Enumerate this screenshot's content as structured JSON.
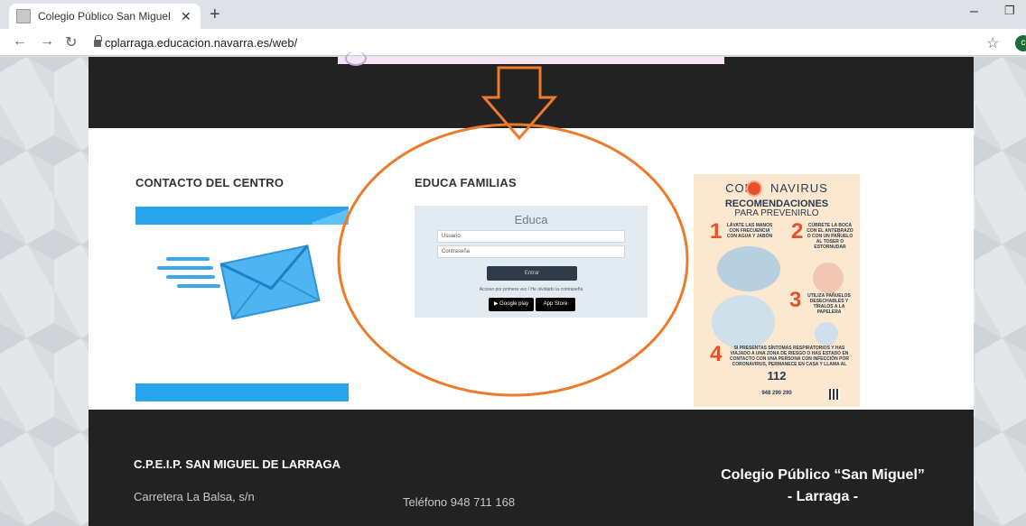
{
  "browser": {
    "tab_title": "Colegio Público San Miguel de L",
    "tab_close": "✕",
    "new_tab": "+",
    "url": "cplarraga.educacion.navarra.es/web/",
    "profile_initial": "c"
  },
  "contact": {
    "heading": "CONTACTO DEL CENTRO"
  },
  "educa": {
    "heading": "EDUCA FAMILIAS",
    "title": "Educa",
    "user_placeholder": "Usuario",
    "password_placeholder": "Contraseña",
    "enter_label": "Entrar",
    "access_text": "Acceso por primera vez / He olvidado la contraseña",
    "google_play": "Google play",
    "app_store": "App Store"
  },
  "poster": {
    "title_left": "COR",
    "title_right": "NAVIRUS",
    "recommendations": "RECOMENDACIONES",
    "prevent": "PARA PREVENIRLO",
    "step1": "LÁVATE LAS MANOS CON FRECUENCIA CON AGUA Y JABÓN",
    "step2": "CÚBRETE LA BOCA CON EL ANTEBRAZO O CON UN PAÑUELO AL TOSER O ESTORNUDAR",
    "step3": "UTILIZA PAÑUELOS DESECHABLES Y TÍRALOS A LA PAPELERA",
    "step4": "SI PRESENTAS SÍNTOMAS RESPIRATORIOS Y HAS VIAJADO A UNA ZONA DE RIESGO O HAS ESTADO EN CONTACTO CON UNA PERSONA CON INFECCIÓN POR CORONAVIRUS, PERMANECE EN CASA Y LLAMA AL",
    "emergency": "112",
    "phone": "948 290 290",
    "num1": "1",
    "num2": "2",
    "num3": "3",
    "num4": "4"
  },
  "footer": {
    "school_name": "C.P.E.I.P. SAN MIGUEL DE LARRAGA",
    "address": "Carretera La Balsa, s/n",
    "phone": "Teléfono 948 711 168",
    "colegio_line1": "Colegio Público “San Miguel”",
    "colegio_line2": "- Larraga -"
  },
  "colors": {
    "annotation_orange": "#ee7a2b",
    "mail_blue": "#29a3ec",
    "dark_bg": "#222222"
  }
}
